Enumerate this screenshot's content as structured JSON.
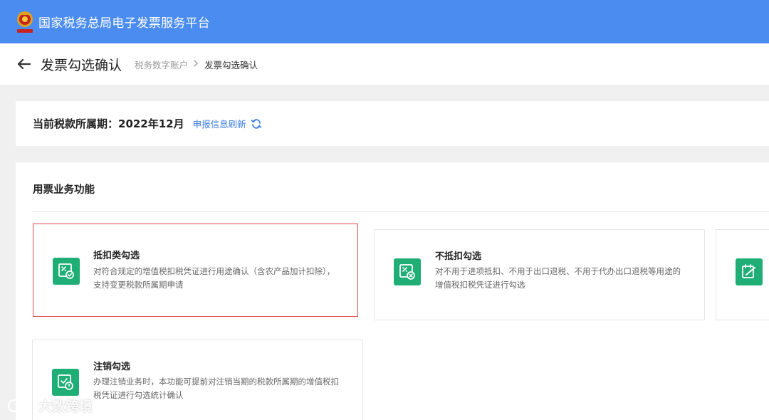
{
  "app": {
    "title": "国家税务总局电子发票服务平台"
  },
  "header": {
    "page_title": "发票勾选确认",
    "breadcrumb": [
      "税务数字账户",
      "发票勾选确认"
    ]
  },
  "period": {
    "label": "当前税款所属期：2022年12月",
    "refresh_link": "申报信息刷新"
  },
  "functions": {
    "section_title": "用票业务功能",
    "cards": [
      {
        "title": "抵扣类勾选",
        "desc_line1": "对符合规定的增值税扣税凭证进行用途确认（含农产品加计扣除），",
        "desc_line2": "支持变更税款所属期申请",
        "icon": "check-invoice-icon",
        "selected": true
      },
      {
        "title": "不抵扣勾选",
        "desc_line1": "对不用于进项抵扣、不用于出口退税、不用于代办出口退税等用途的",
        "desc_line2": "增值税扣税凭证进行勾选",
        "icon": "no-deduct-invoice-icon",
        "selected": false
      },
      {
        "title": "注销勾选",
        "desc_line1": "办理注销业务时，本功能可提前对注销当期的税款所属期的增值税扣",
        "desc_line2": "税凭证进行勾选统计确认",
        "icon": "cancel-invoice-icon",
        "selected": false
      }
    ]
  },
  "watermark": {
    "text": "大数跨境"
  },
  "colors": {
    "topbar": "#4b8cf0",
    "accent_green": "#1fae76",
    "link_blue": "#3c7de6",
    "selected_border": "#e04848"
  }
}
